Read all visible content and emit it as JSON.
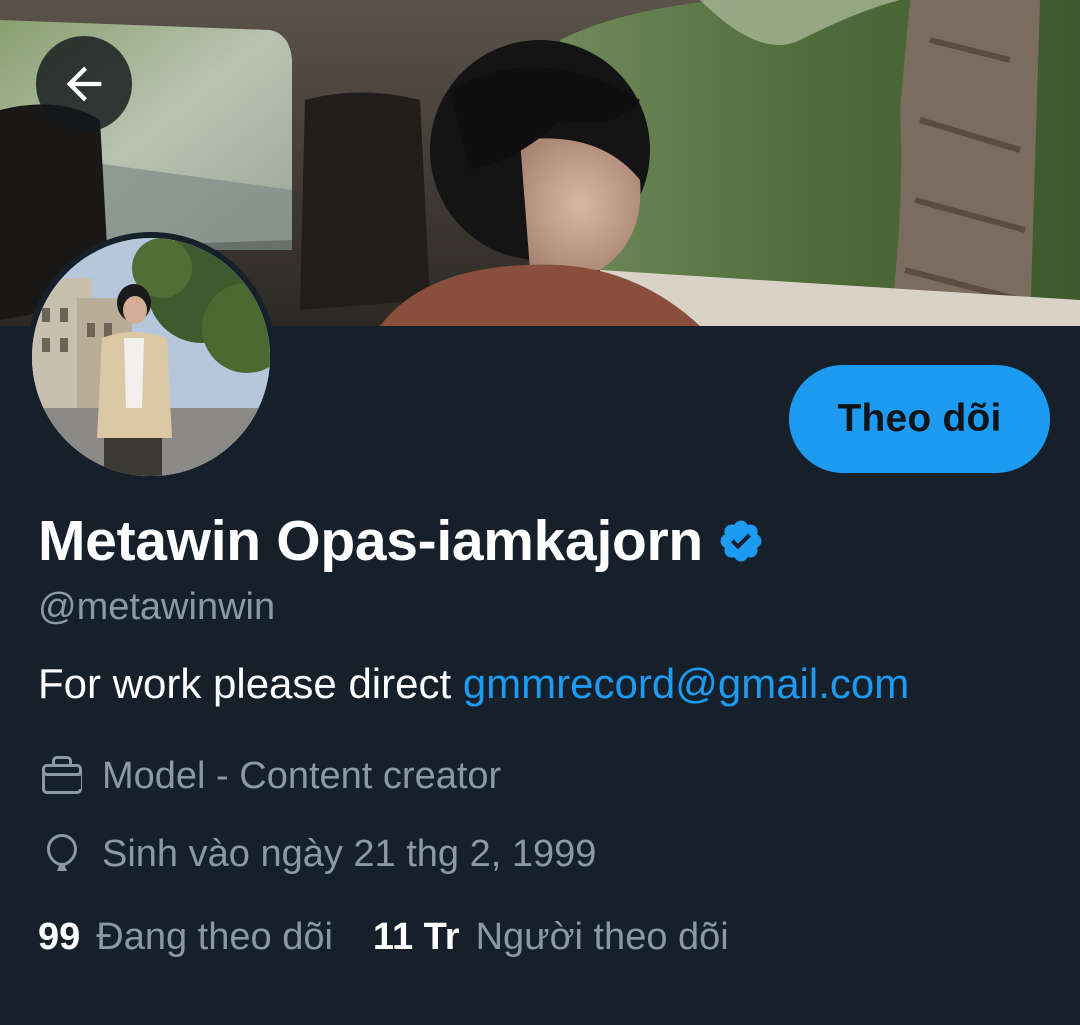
{
  "header": {
    "back_icon": "arrow-left-icon"
  },
  "profile": {
    "display_name": "Metawin Opas-iamkajorn",
    "verified_icon": "verified-badge-icon",
    "handle": "@metawinwin",
    "bio_text": "For work please direct ",
    "bio_link": "gmmrecord@gmail.com",
    "occupation_icon": "briefcase-icon",
    "occupation": "Model - Content creator",
    "birthday_icon": "balloon-icon",
    "birthday": "Sinh vào ngày 21 thg 2, 1999"
  },
  "actions": {
    "follow_label": "Theo dõi"
  },
  "stats": {
    "following_count": "99",
    "following_label": "Đang theo dõi",
    "followers_count": "11 Tr",
    "followers_label": "Người theo dõi"
  },
  "colors": {
    "background": "#15202b",
    "accent": "#1d9bf0",
    "secondary_text": "#8b98a5"
  }
}
